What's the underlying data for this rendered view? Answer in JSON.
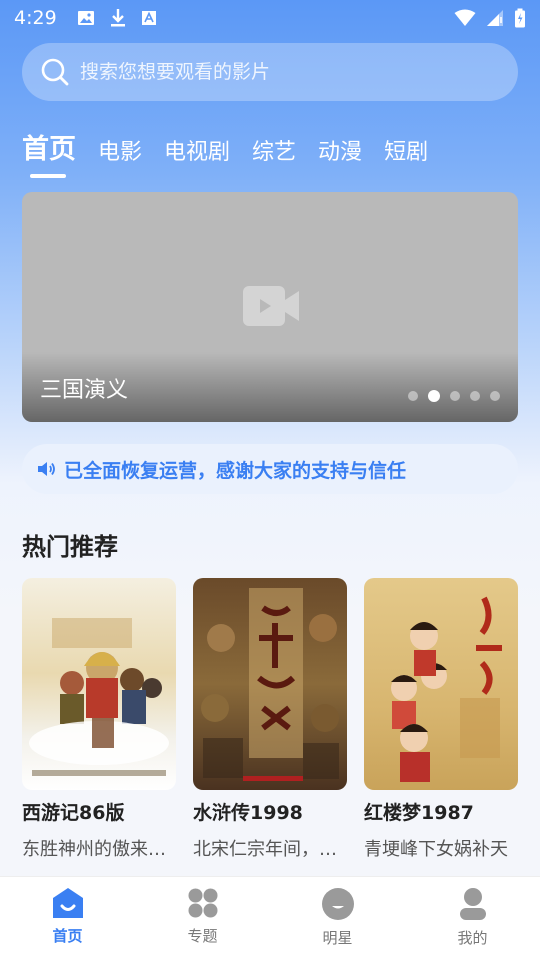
{
  "status_bar": {
    "time": "4:29"
  },
  "search": {
    "placeholder": "搜索您想要观看的影片"
  },
  "tabs": [
    {
      "label": "首页",
      "active": true
    },
    {
      "label": "电影",
      "active": false
    },
    {
      "label": "电视剧",
      "active": false
    },
    {
      "label": "综艺",
      "active": false
    },
    {
      "label": "动漫",
      "active": false
    },
    {
      "label": "短剧",
      "active": false
    }
  ],
  "banner": {
    "title": "三国演义",
    "slide_count": 5,
    "active_slide": 2
  },
  "notice": {
    "text": "已全面恢复运营，感谢大家的支持与信任",
    "icon": "speaker-icon"
  },
  "section": {
    "title": "热门推荐"
  },
  "cards": [
    {
      "title": "西游记86版",
      "desc": "东胜神州的傲来国花果山"
    },
    {
      "title": "水浒传1998",
      "desc": "北宋仁宗年间，瘟疫"
    },
    {
      "title": "红楼梦1987",
      "desc": "青埂峰下女娲补天"
    }
  ],
  "bottom_nav": [
    {
      "label": "首页",
      "icon": "home-icon",
      "active": true
    },
    {
      "label": "专题",
      "icon": "grid-icon",
      "active": false
    },
    {
      "label": "明星",
      "icon": "star-face-icon",
      "active": false
    },
    {
      "label": "我的",
      "icon": "profile-icon",
      "active": false
    }
  ],
  "colors": {
    "accent": "#3a7ff2",
    "gradient_top": "#5b98f6"
  }
}
